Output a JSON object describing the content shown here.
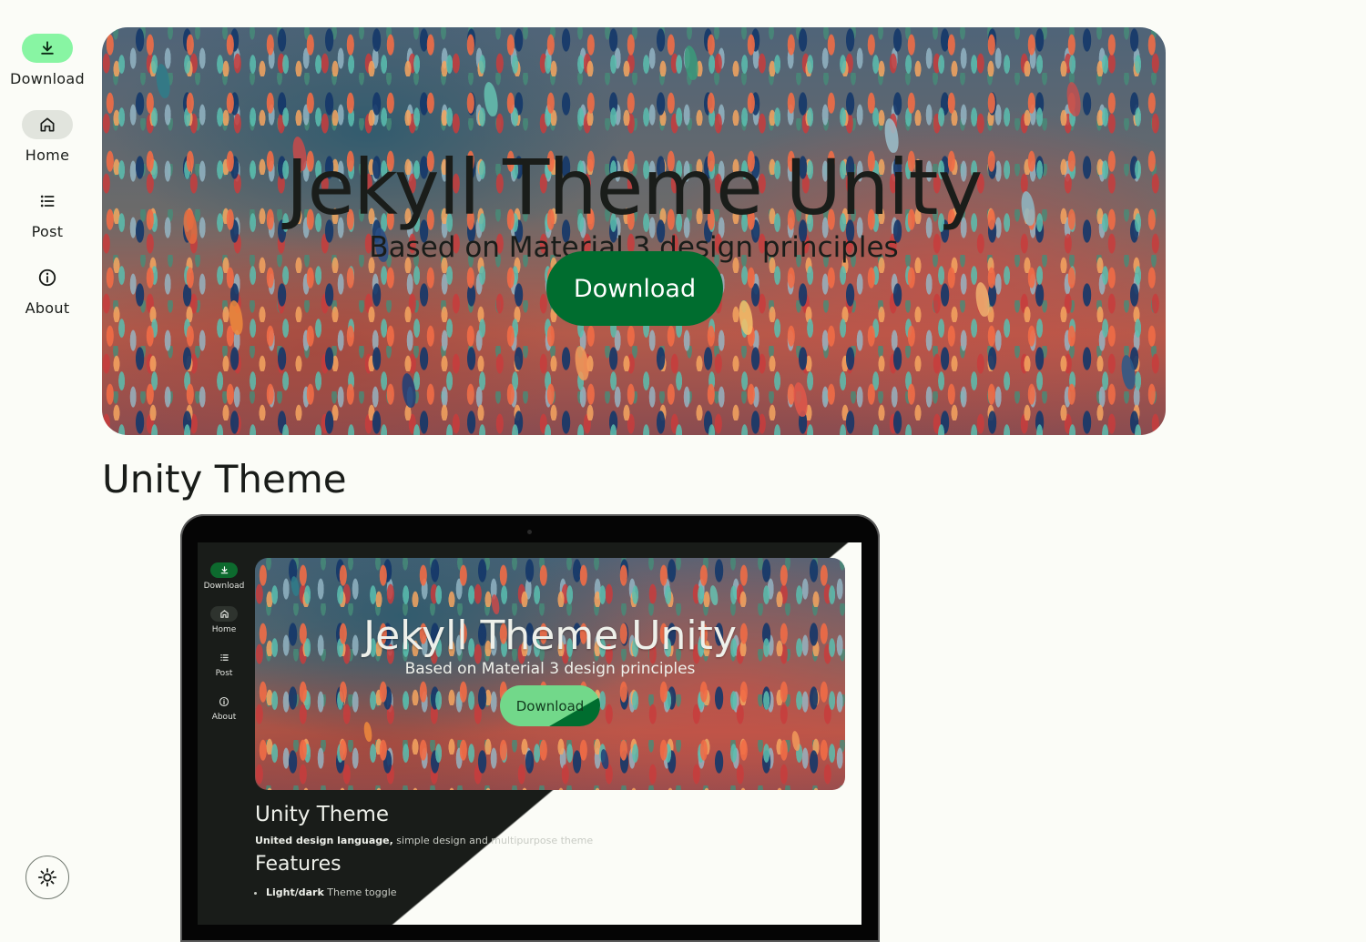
{
  "nav": {
    "items": [
      {
        "label": "Download",
        "icon": "download-icon"
      },
      {
        "label": "Home",
        "icon": "home-icon"
      },
      {
        "label": "Post",
        "icon": "list-icon"
      },
      {
        "label": "About",
        "icon": "info-icon"
      }
    ],
    "theme_toggle_icon": "sun-icon"
  },
  "hero": {
    "title": "Jekyll Theme Unity",
    "subtitle": "Based on Material 3 design principles",
    "button_label": "Download"
  },
  "section": {
    "title": "Unity Theme"
  },
  "preview": {
    "nav": [
      "Download",
      "Home",
      "Post",
      "About"
    ],
    "hero_title": "Jekyll Theme Unity",
    "hero_subtitle": "Based on Material 3 design principles",
    "hero_button": "Download",
    "section_title": "Unity Theme",
    "desc_bold": "United design language,",
    "desc_rest": " simple design and multipurpose theme",
    "features_title": "Features",
    "feature_bold": "Light/dark",
    "feature_rest": " Theme toggle"
  },
  "colors": {
    "background": "#fbfcf7",
    "primary": "#006d2f",
    "primary_container": "#88f5a3",
    "surface_dark": "#191c19"
  }
}
